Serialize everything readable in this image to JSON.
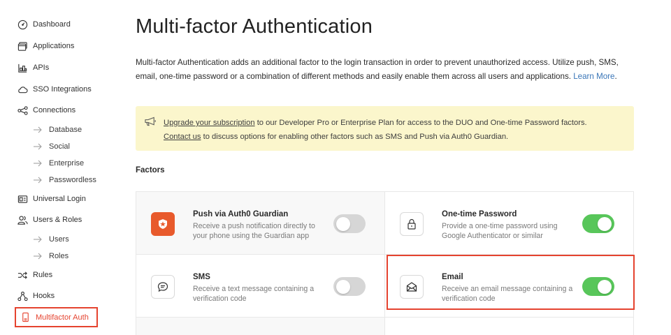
{
  "sidebar": {
    "items": [
      {
        "label": "Dashboard",
        "icon": "speedometer-icon"
      },
      {
        "label": "Applications",
        "icon": "windows-icon"
      },
      {
        "label": "APIs",
        "icon": "apis-icon"
      },
      {
        "label": "SSO Integrations",
        "icon": "cloud-icon"
      },
      {
        "label": "Connections",
        "icon": "connections-icon"
      },
      {
        "label": "Universal Login",
        "icon": "login-icon"
      },
      {
        "label": "Users & Roles",
        "icon": "users-icon"
      },
      {
        "label": "Rules",
        "icon": "shuffle-icon"
      },
      {
        "label": "Hooks",
        "icon": "hooks-icon"
      },
      {
        "label": "Multifactor Auth",
        "icon": "phone-icon",
        "active": true
      }
    ],
    "connections_sub": [
      "Database",
      "Social",
      "Enterprise",
      "Passwordless"
    ],
    "users_sub": [
      "Users",
      "Roles"
    ]
  },
  "main": {
    "title": "Multi-factor Authentication",
    "intro": "Multi-factor Authentication adds an additional factor to the login transaction in order to prevent unauthorized access. Utilize push, SMS, email, one-time password or a combination of different methods and easily enable them across all users and applications.",
    "learn_more": "Learn More",
    "notice": {
      "upgrade_link": "Upgrade your subscription",
      "line1_rest": " to our Developer Pro or Enterprise Plan for access to the DUO and One-time Password factors.",
      "contact_link": "Contact us",
      "line2_rest": " to discuss options for enabling other factors such as SMS and Push via Auth0 Guardian."
    },
    "factors_heading": "Factors",
    "factors": [
      {
        "title": "Push via Auth0 Guardian",
        "desc": "Receive a push notification directly to your phone using the Guardian app",
        "enabled": false,
        "icon": "guardian-icon"
      },
      {
        "title": "One-time Password",
        "desc": "Provide a one-time password using Google Authenticator or similar",
        "enabled": true,
        "icon": "lock-icon"
      },
      {
        "title": "SMS",
        "desc": "Receive a text message containing a verification code",
        "enabled": false,
        "icon": "chat-icon"
      },
      {
        "title": "Email",
        "desc": "Receive an email message containing a verification code",
        "enabled": true,
        "icon": "envelope-icon"
      }
    ]
  },
  "colors": {
    "accent": "#e5432f",
    "toggle_on": "#58c65a",
    "toggle_off": "#d6d6d6",
    "link": "#3a76b8",
    "notice_bg": "#fbf6cc"
  }
}
